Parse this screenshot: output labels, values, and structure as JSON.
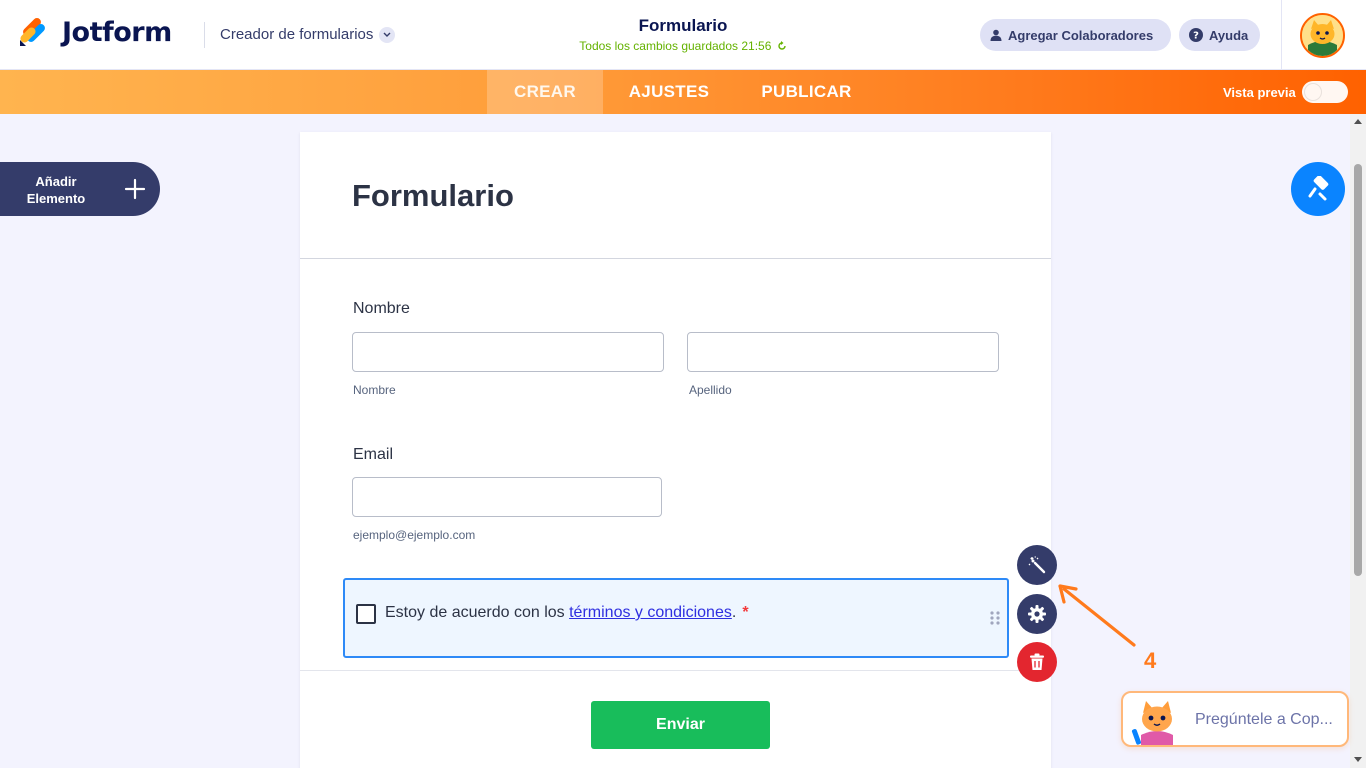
{
  "header": {
    "logo_text": "Jotform",
    "builder_label": "Creador de formularios",
    "form_title": "Formulario",
    "saved_status": "Todos los cambios guardados 21:56",
    "collaborators_label": "Agregar Colaboradores",
    "help_label": "Ayuda"
  },
  "nav": {
    "tabs": [
      {
        "label": "CREAR",
        "active": true
      },
      {
        "label": "AJUSTES",
        "active": false
      },
      {
        "label": "PUBLICAR",
        "active": false
      }
    ],
    "preview_label": "Vista previa",
    "preview_enabled": false
  },
  "sidebar": {
    "add_element_label": "Añadir Elemento"
  },
  "form": {
    "heading": "Formulario",
    "name_field": {
      "label": "Nombre",
      "first_value": "",
      "last_value": "",
      "first_sublabel": "Nombre",
      "last_sublabel": "Apellido"
    },
    "email_field": {
      "label": "Email",
      "value": "",
      "sublabel": "ejemplo@ejemplo.com"
    },
    "terms": {
      "prefix": "Estoy de acuerdo con los ",
      "link_text": "términos y condiciones",
      "suffix": ".",
      "required_mark": "*",
      "checked": false
    },
    "submit_label": "Enviar"
  },
  "annotation": {
    "step_number": "4"
  },
  "copilot": {
    "label": "Pregúntele a Cop..."
  },
  "colors": {
    "brand_orange": "#ff6100",
    "navy": "#0a1551",
    "submit_green": "#18bd5b",
    "selection_blue": "#2e8af7",
    "delete_red": "#e3262f"
  }
}
